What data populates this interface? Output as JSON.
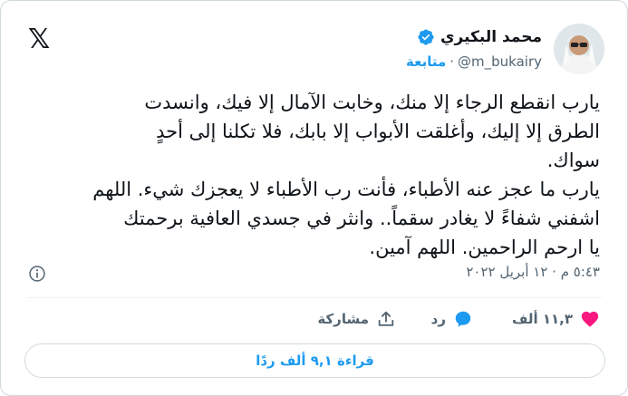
{
  "header": {
    "display_name": "محمد البكيري",
    "handle": "@m_bukairy",
    "separator": "·",
    "follow_label": "متابعة",
    "logo_icon": "x-logo-icon",
    "logo_glyph": "𝕏"
  },
  "tweet": {
    "text": "يارب انقطع الرجاء إلا منك، وخابت الآمال إلا فيك، وانسدت\nالطرق إلا إليك، وأغلقت الأبواب إلا بابك، فلا تكلنا إلى أحدٍ\nسواك.\nيارب ما عجز عنه الأطباء، فأنت رب الأطباء لا يعجزك شيء. اللهم\nاشفني شفاءً لا يغادر سقماً.. وانثر في جسدي العافية برحمتك\nيا ارحم الراحمين. اللهم آمين.",
    "timestamp": "٥:٤٣ م · ١٢ أبريل ٢٠٢٢"
  },
  "actions": {
    "like_count": "١١,٣ ألف",
    "reply_label": "رد",
    "share_label": "مشاركة"
  },
  "replies_button": "قراءة ٩,١ ألف ردًا",
  "colors": {
    "accent": "#1d9bf0",
    "like": "#f91880",
    "text": "#0f1419",
    "muted": "#536471"
  }
}
